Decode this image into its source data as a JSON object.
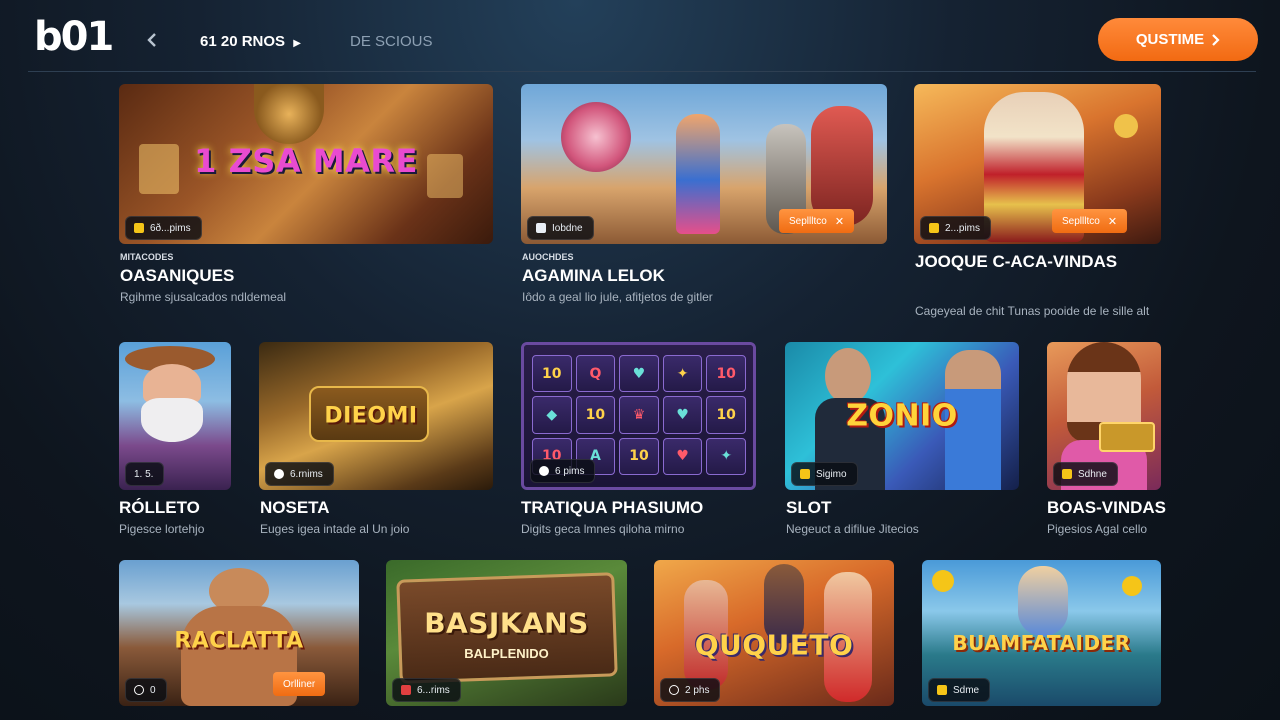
{
  "header": {
    "logo": "b01",
    "nav_primary": "61 20 RNOS",
    "nav_secondary": "DE SCIOUS",
    "cta_label": "QUSTIME"
  },
  "icons": {
    "back": "chevron-left-icon",
    "nav_arrow": "play-arrow-icon",
    "cta_arrow": "chevron-right-icon"
  },
  "colors": {
    "accent": "#f5781f",
    "background": "#0e151e"
  },
  "row1": [
    {
      "thumb_title": "1 ZSA MARE",
      "badge": "6ð...pims",
      "category": "MITACODES",
      "title": "OASANIQUES",
      "desc": "Rgihme sjusalcados ndldemeal"
    },
    {
      "thumb_title": "",
      "badge": "Iobdne",
      "offer": "Sepllltco",
      "category": "AUOCHDES",
      "title": "AGAMINA LELOK",
      "desc": "Iôdo a geal lio jule, afitjetos de gitler"
    },
    {
      "thumb_title": "",
      "badge": "2...pims",
      "offer": "Sepllltco",
      "category": "",
      "title": "JOOQUE C-ACA-VINDAS",
      "desc": "Cageyeal de chit Tunas pooide de le sille alt"
    }
  ],
  "row2": [
    {
      "thumb_title": "",
      "badge": "1. 5.",
      "title": "RÓLLETO",
      "desc": "Pigesce lortehjo"
    },
    {
      "thumb_title": "DIEOMI",
      "badge": "6.rnims",
      "title": "NOSETA",
      "desc": "Euges igea intade al Un joio"
    },
    {
      "thumb_title": "",
      "badge": "6 pims",
      "title": "TRATIQUA PHASIUMO",
      "desc": "Digits geca lmnes qiloha mirno"
    },
    {
      "thumb_title": "ZONIO",
      "badge": "Sigimo",
      "title": "SLOT",
      "desc": "Negeuct a difilue Jitecios"
    },
    {
      "thumb_title": "",
      "badge": "Sdhne",
      "title": "BOAS-VINDAS",
      "desc": "Pigesios Agal cello"
    }
  ],
  "row3": [
    {
      "thumb_title": "RACLATTA",
      "badge": "0",
      "offer": "Orlliner"
    },
    {
      "thumb_title": "BASJKANS",
      "subtitle": "BALPLENIDO",
      "badge": "6...rims"
    },
    {
      "thumb_title": "QUQUETO",
      "badge": "2 phs"
    },
    {
      "thumb_title": "BUAMFATAIDER",
      "badge": "Sdme"
    }
  ],
  "slot_symbols": [
    "10",
    "Q",
    "♥",
    "✦",
    "10",
    "◆",
    "10",
    "♛",
    "♥",
    "10",
    "10",
    "A",
    "10",
    "♥",
    "✦"
  ]
}
